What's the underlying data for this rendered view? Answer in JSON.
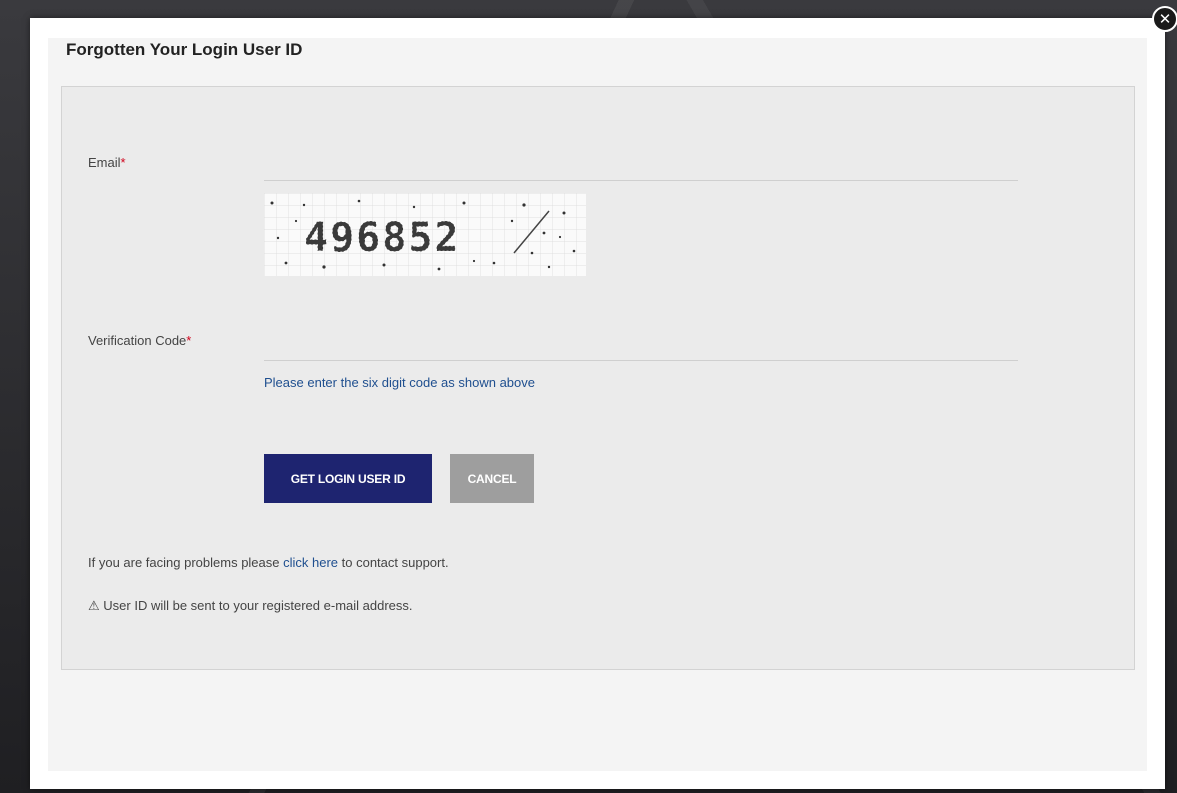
{
  "modal": {
    "title": "Forgotten Your Login User ID",
    "close_glyph": "✕"
  },
  "form": {
    "email_label": "Email",
    "email_value": "",
    "required_mark": "*",
    "captcha_code": "496852",
    "verification_label": "Verification Code",
    "verification_value": "",
    "hint": "Please enter the six digit code as shown above",
    "submit_label": "GET LOGIN USER ID",
    "cancel_label": "CANCEL"
  },
  "footer": {
    "support_prefix": "If you are facing problems please ",
    "support_link": "click here",
    "support_suffix": " to contact support.",
    "warning_icon": "⚠",
    "warning_text": " User ID will be sent to your registered e-mail address."
  },
  "colors": {
    "primary": "#1e2470",
    "cancel": "#9e9e9e",
    "link": "#1f4f8f",
    "required": "#d0021b"
  }
}
